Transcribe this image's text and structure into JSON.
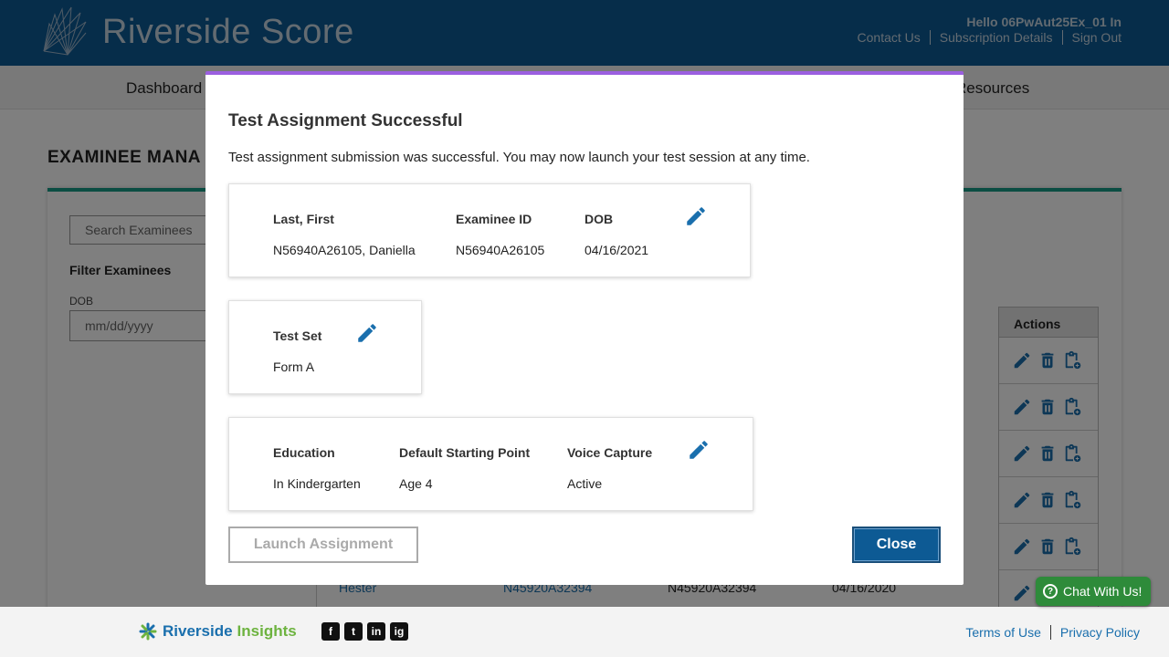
{
  "header": {
    "brand": "Riverside Score",
    "greeting": "Hello 06PwAut25Ex_01 In",
    "links": [
      "Contact Us",
      "Subscription Details",
      "Sign Out"
    ]
  },
  "nav": {
    "dashboard": "Dashboard",
    "resources": "Resources"
  },
  "page": {
    "title": "EXAMINEE MANA",
    "search_placeholder": "Search Examinees",
    "filter_title": "Filter Examinees",
    "dob_label": "DOB",
    "dob_placeholder": "mm/dd/yyyy",
    "actions_header": "Actions",
    "last_row": {
      "name": "Hester",
      "id_link": "N45920A32394",
      "id": "N45920A32394",
      "dob": "04/16/2020"
    }
  },
  "footer": {
    "brand_a": "Riverside",
    "brand_b": "Insights",
    "social": [
      "f",
      "t",
      "in",
      "ig"
    ],
    "terms": "Terms of Use",
    "privacy": "Privacy Policy"
  },
  "chat": {
    "label": "Chat With Us!"
  },
  "modal": {
    "title": "Test Assignment Successful",
    "message": "Test assignment submission was successful. You may now launch your test session at any time.",
    "examinee": {
      "name_label": "Last, First",
      "name_value": "N56940A26105, Daniella",
      "id_label": "Examinee ID",
      "id_value": "N56940A26105",
      "dob_label": "DOB",
      "dob_value": "04/16/2021"
    },
    "test_set": {
      "label": "Test Set",
      "value": "Form A"
    },
    "settings": {
      "education_label": "Education",
      "education_value": "In Kindergarten",
      "start_label": "Default Starting Point",
      "start_value": "Age 4",
      "voice_label": "Voice Capture",
      "voice_value": "Active"
    },
    "launch_label": "Launch Assignment",
    "close_label": "Close"
  },
  "colors": {
    "header_bg": "#0d5a94",
    "accent_purple": "#9b5fe0",
    "accent_teal": "#179a86",
    "link_blue": "#1a6fad",
    "chat_green": "#2e8b3a"
  }
}
